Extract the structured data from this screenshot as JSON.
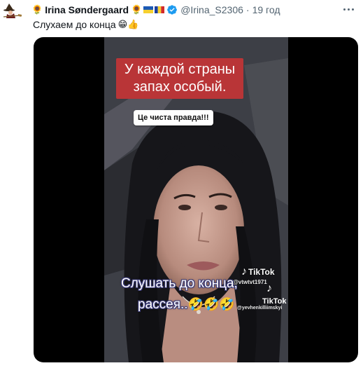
{
  "tweet": {
    "name": "Irina Søndergaard",
    "name_emoji": "🌻",
    "flags": [
      "ukraine-flag",
      "moldova-flag"
    ],
    "handle": "@Irina_S2306",
    "separator": "·",
    "time": "19 год",
    "text": "Слухаем до конца",
    "text_emojis": "😁👍",
    "more_icon": "more-dots-icon"
  },
  "media": {
    "caption_top": "У каждой страны запах особый.",
    "pill_text": "Це чиста правда!!!",
    "caption_bottom_line1": "Слушать до конца,",
    "caption_bottom_line2": "рассея..",
    "caption_bottom_emojis": "🤣🤣🤣",
    "tiktok_label_1": "TikTok",
    "tiktok_user_1": "@vtwtvt1971",
    "tiktok_label_2": "TikTok",
    "tiktok_user_2": "@yevhenkilliimskyi"
  },
  "colors": {
    "text_primary": "#0f1419",
    "text_secondary": "#536471",
    "verified_blue": "#1d9bf0",
    "caption_red": "#b93537"
  }
}
